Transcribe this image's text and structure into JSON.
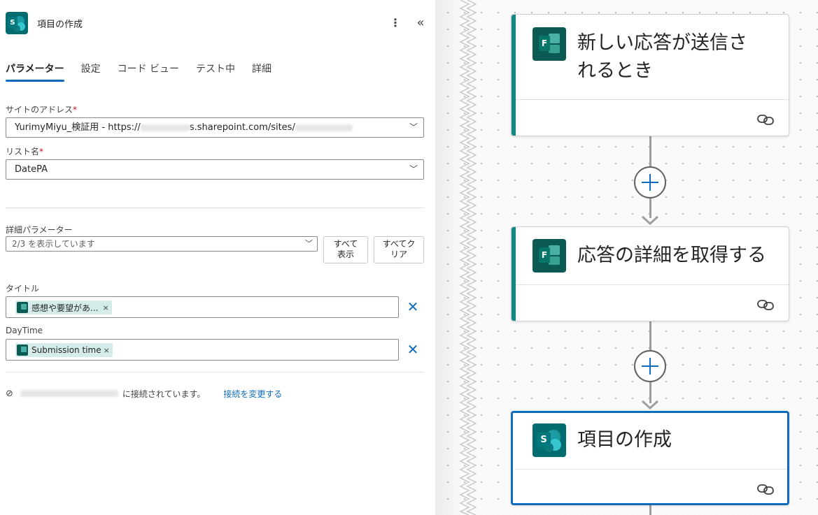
{
  "panel": {
    "title": "項目の作成",
    "menu_icon": "more-vertical-icon",
    "collapse_icon": "chevron-double-left-icon",
    "tabs": [
      {
        "label": "パラメーター",
        "active": true
      },
      {
        "label": "設定",
        "active": false
      },
      {
        "label": "コード ビュー",
        "active": false
      },
      {
        "label": "テスト中",
        "active": false
      },
      {
        "label": "詳細",
        "active": false
      }
    ],
    "site": {
      "label": "サイトのアドレス",
      "required_mark": "*",
      "value_prefix": "YurimyMiyu_検証用 - https://",
      "value_mid": "s.sharepoint.com/sites/"
    },
    "list": {
      "label": "リスト名",
      "required_mark": "*",
      "value": "DatePA"
    },
    "advanced": {
      "label": "詳細パラメーター",
      "value": "2/3 を表示しています",
      "show_all_line1": "すべて",
      "show_all_line2": "表示",
      "clear_all_line1": "すべてク",
      "clear_all_line2": "リア"
    },
    "title_field": {
      "label": "タイトル",
      "token": "感想や要望があ...",
      "token_remove": "×"
    },
    "daytime_field": {
      "label": "DayTime",
      "token": "Submission time",
      "token_remove": "×"
    },
    "connection": {
      "status": "に接続されています。",
      "change_link": "接続を変更する"
    }
  },
  "canvas": {
    "cards": [
      {
        "title_line1": "新しい応答が送信さ",
        "title_line2": "れるとき",
        "icon": "microsoft-forms-icon",
        "selected": false
      },
      {
        "title_line1": "応答の詳細を取得する",
        "icon": "microsoft-forms-icon",
        "selected": false
      },
      {
        "title_line1": "項目の作成",
        "icon": "sharepoint-icon",
        "selected": true
      }
    ],
    "colors": {
      "accent": "#0f6cbd",
      "forms_bar": "#0d8a83",
      "sharepoint": "#036c70"
    }
  }
}
